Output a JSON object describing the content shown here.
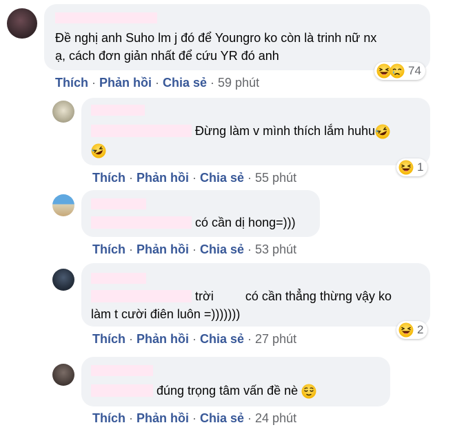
{
  "comments": [
    {
      "text_lines": [
        "Đề nghị anh Suho lm j đó để Youngro ko còn là trinh nữ nx",
        "ạ, cách đơn giản nhất để cứu YR đó anh"
      ],
      "actions": {
        "like": "Thích",
        "reply": "Phản hồi",
        "share": "Chia sẻ",
        "time": "59 phút"
      },
      "reactions": {
        "icons": [
          "laughing-emoji",
          "crying-emoji"
        ],
        "count": "74"
      }
    },
    {
      "text_lines": [
        "Đừng làm v mình thích lắm huhu",
        ""
      ],
      "actions": {
        "like": "Thích",
        "reply": "Phản hồi",
        "share": "Chia sẻ",
        "time": "55 phút"
      },
      "reactions": {
        "icons": [
          "laughing-emoji"
        ],
        "count": "1"
      }
    },
    {
      "text_lines": [
        "có cần dị hong=)))"
      ],
      "actions": {
        "like": "Thích",
        "reply": "Phản hồi",
        "share": "Chia sẻ",
        "time": "53 phút"
      }
    },
    {
      "text_lines": [
        "trời",
        "có cần thẳng thừng vậy ko",
        "làm t cười điên luôn =)))))))"
      ],
      "actions": {
        "like": "Thích",
        "reply": "Phản hồi",
        "share": "Chia sẻ",
        "time": "27 phút"
      },
      "reactions": {
        "icons": [
          "laughing-emoji"
        ],
        "count": "2"
      }
    },
    {
      "text_lines": [
        "đúng trọng tâm vấn đề nè"
      ],
      "actions": {
        "like": "Thích",
        "reply": "Phản hồi",
        "share": "Chia sẻ",
        "time": "24 phút"
      }
    }
  ],
  "separator": "·",
  "colors": {
    "bubble": "#f0f2f5",
    "action": "#385898",
    "meta": "#65676b",
    "redaction": "#ffe8f3"
  }
}
